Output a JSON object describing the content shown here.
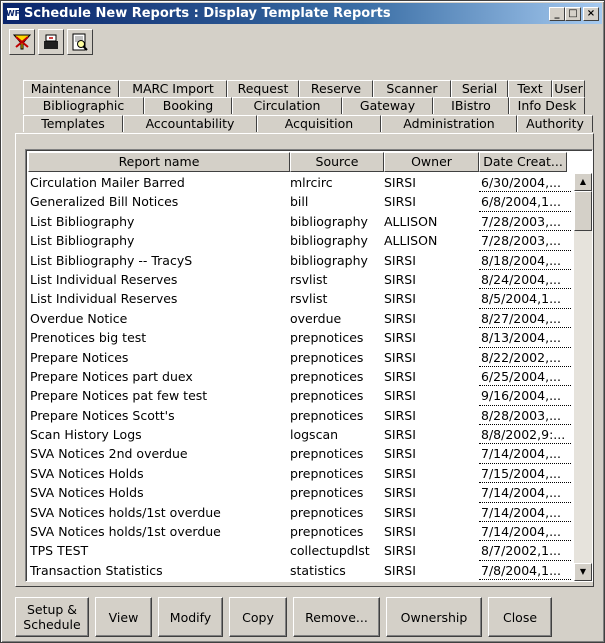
{
  "window": {
    "title": "Schedule New Reports : Display Template Reports",
    "app_icon_text": "WF",
    "minimize": "_",
    "maximize": "□",
    "close": "×"
  },
  "toolbar": {
    "icons": [
      "filter-icon",
      "tray-icon",
      "report-search-icon"
    ]
  },
  "tabs": {
    "row1": [
      "Maintenance",
      "MARC Import",
      "Request",
      "Reserve",
      "Scanner",
      "Serial",
      "Text",
      "User"
    ],
    "row2": [
      "Bibliographic",
      "Booking",
      "Circulation",
      "Gateway",
      "IBistro",
      "Info Desk"
    ],
    "row3": [
      "Templates",
      "Accountability",
      "Acquisition",
      "Administration",
      "Authority"
    ],
    "active": "Templates"
  },
  "table": {
    "columns": [
      "Report name",
      "Source",
      "Owner",
      "Date Creat..."
    ],
    "rows": [
      [
        "Circulation Mailer Barred",
        "mlrcirc",
        "SIRSI",
        "6/30/2004,..."
      ],
      [
        "Generalized Bill Notices",
        "bill",
        "SIRSI",
        "6/8/2004,1..."
      ],
      [
        "List Bibliography",
        "bibliography",
        "ALLISON",
        "7/28/2003,..."
      ],
      [
        "List Bibliography",
        "bibliography",
        "ALLISON",
        "7/28/2003,..."
      ],
      [
        "List Bibliography -- TracyS",
        "bibliography",
        "SIRSI",
        "8/18/2004,..."
      ],
      [
        "List Individual Reserves",
        "rsvlist",
        "SIRSI",
        "8/24/2004,..."
      ],
      [
        "List Individual Reserves",
        "rsvlist",
        "SIRSI",
        "8/5/2004,1..."
      ],
      [
        "Overdue Notice",
        "overdue",
        "SIRSI",
        "8/27/2004,..."
      ],
      [
        "Prenotices big test",
        "prepnotices",
        "SIRSI",
        "8/13/2004,..."
      ],
      [
        "Prepare Notices",
        "prepnotices",
        "SIRSI",
        "8/22/2002,..."
      ],
      [
        "Prepare Notices part duex",
        "prepnotices",
        "SIRSI",
        "6/25/2004,..."
      ],
      [
        "Prepare Notices pat few test",
        "prepnotices",
        "SIRSI",
        "9/16/2004,..."
      ],
      [
        "Prepare Notices Scott's",
        "prepnotices",
        "SIRSI",
        "8/28/2003,..."
      ],
      [
        "Scan History Logs",
        "logscan",
        "SIRSI",
        "8/8/2002,9:..."
      ],
      [
        "SVA  Notices 2nd overdue",
        "prepnotices",
        "SIRSI",
        "7/14/2004,..."
      ],
      [
        "SVA  Notices Holds",
        "prepnotices",
        "SIRSI",
        "7/15/2004,..."
      ],
      [
        "SVA  Notices Holds",
        "prepnotices",
        "SIRSI",
        "7/14/2004,..."
      ],
      [
        "SVA  Notices holds/1st overdue",
        "prepnotices",
        "SIRSI",
        "7/14/2004,..."
      ],
      [
        "SVA  Notices holds/1st overdue",
        "prepnotices",
        "SIRSI",
        "7/14/2004,..."
      ],
      [
        "TPS TEST",
        "collectupdlst",
        "SIRSI",
        "8/7/2002,1..."
      ],
      [
        "Transaction Statistics",
        "statistics",
        "SIRSI",
        "7/8/2004,1..."
      ]
    ]
  },
  "buttons": {
    "setup": "Setup &\nSchedule",
    "view": "View",
    "modify": "Modify",
    "copy": "Copy",
    "remove": "Remove...",
    "ownership": "Ownership",
    "close": "Close"
  }
}
